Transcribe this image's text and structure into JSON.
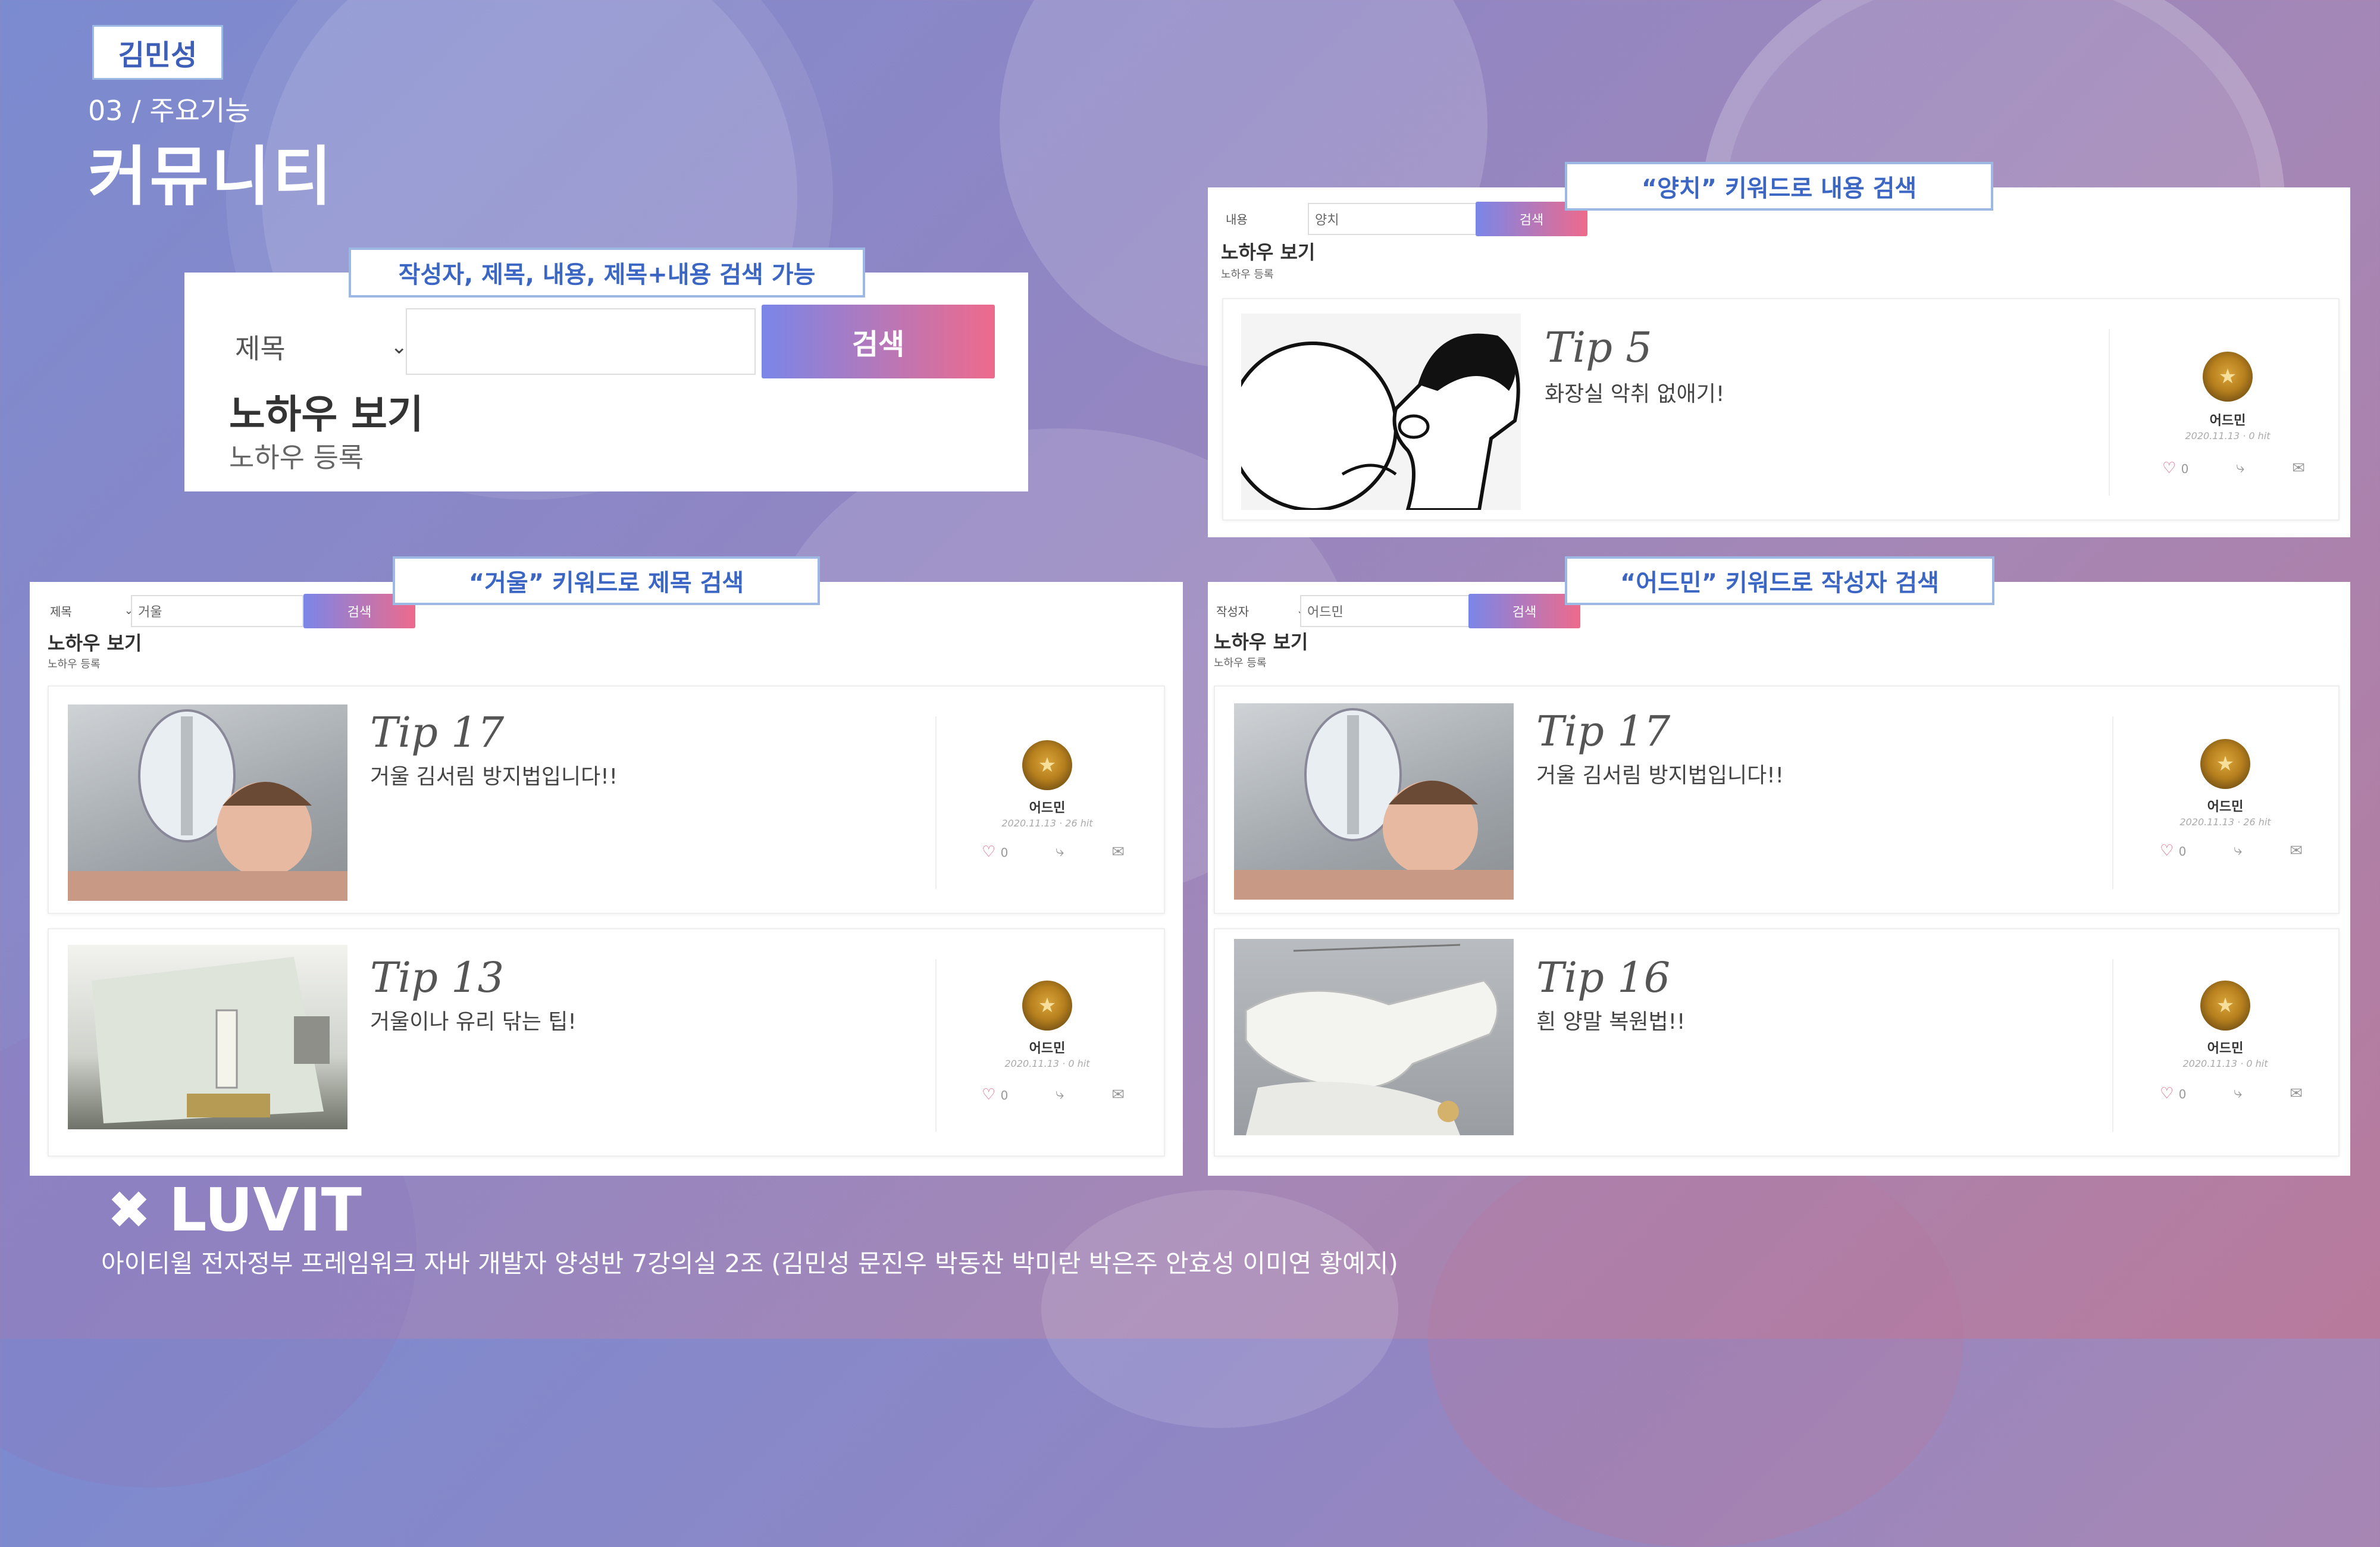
{
  "header": {
    "author_badge": "김민성",
    "section_no": "03 / 주요기능",
    "section_title": "커뮤니티"
  },
  "panel_search": {
    "callout": "작성자, 제목, 내용, 제목+내용 검색 가능",
    "select_value": "제목",
    "input_value": "",
    "search_button": "검색",
    "heading": "노하우 보기",
    "subheading": "노하우 등록"
  },
  "panel_content": {
    "callout": "“양치” 키워드로 내용 검색",
    "select_value": "내용",
    "input_value": "양치",
    "search_button": "검색",
    "heading": "노하우 보기",
    "subheading": "노하우 등록",
    "posts": [
      {
        "title": "Tip 5",
        "desc": "화장실 악취 없애기!",
        "author": "어드민",
        "meta": "2020.11.13 · 0 hit",
        "likes": "0"
      }
    ]
  },
  "panel_title": {
    "callout": "“거울” 키워드로 제목 검색",
    "select_value": "제목",
    "input_value": "거울",
    "search_button": "검색",
    "heading": "노하우 보기",
    "subheading": "노하우 등록",
    "posts": [
      {
        "title": "Tip 17",
        "desc": "거울 김서림 방지법입니다!!",
        "author": "어드민",
        "meta": "2020.11.13 · 26 hit",
        "likes": "0"
      },
      {
        "title": "Tip 13",
        "desc": "거울이나 유리 닦는 팁!",
        "author": "어드민",
        "meta": "2020.11.13 · 0 hit",
        "likes": "0"
      }
    ]
  },
  "panel_author": {
    "callout": "“어드민” 키워드로 작성자 검색",
    "select_value": "작성자",
    "input_value": "어드민",
    "search_button": "검색",
    "heading": "노하우 보기",
    "subheading": "노하우 등록",
    "posts": [
      {
        "title": "Tip 17",
        "desc": "거울 김서림 방지법입니다!!",
        "author": "어드민",
        "meta": "2020.11.13 · 26 hit",
        "likes": "0"
      },
      {
        "title": "Tip 16",
        "desc": "흰 양말 복원법!!",
        "author": "어드민",
        "meta": "2020.11.13 · 0 hit",
        "likes": "0"
      }
    ]
  },
  "footer": {
    "logo_text": "LUVIT",
    "logo_icon": "fork-knife-icon",
    "credits": "아이티윌 전자정부 프레임워크 자바 개발자 양성반 7강의실 2조 (김민성 문진우 박동찬 박미란 박은주 안효성 이미연 황예지)"
  },
  "colors": {
    "accent_blue": "#3b66c4",
    "button_gradient_start": "#7a86e8",
    "button_gradient_end": "#ee6a8c",
    "heart": "#e85a7a"
  }
}
